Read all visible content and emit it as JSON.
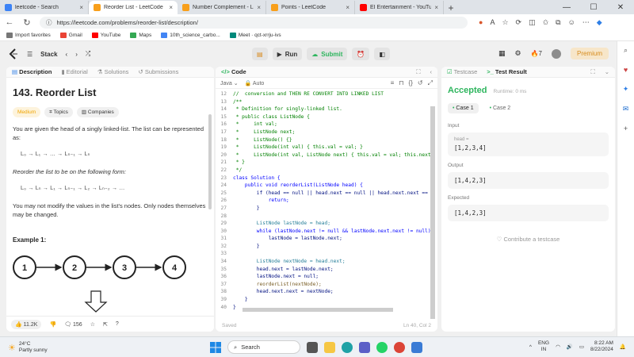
{
  "browser": {
    "tabs": [
      {
        "label": "leetcode - Search",
        "active": false,
        "color": "#3b82f6"
      },
      {
        "label": "Reorder List - LeetCode",
        "active": true,
        "color": "#f89f1b"
      },
      {
        "label": "Number Complement - LeetCode",
        "active": false,
        "color": "#f89f1b"
      },
      {
        "label": "Points - LeetCode",
        "active": false,
        "color": "#f89f1b"
      },
      {
        "label": "EI Entertainment - YouTube",
        "active": false,
        "color": "#ff0000"
      }
    ],
    "url": "https://leetcode.com/problems/reorder-list/description/",
    "bookmarks": [
      {
        "label": "Import favorites",
        "color": "#777777"
      },
      {
        "label": "Gmail",
        "color": "#ea4335"
      },
      {
        "label": "YouTube",
        "color": "#ff0000"
      },
      {
        "label": "Maps",
        "color": "#34a853"
      },
      {
        "label": "10th_science_carbo...",
        "color": "#4285f4"
      },
      {
        "label": "Meet · qct-xrrju-ivs",
        "color": "#00897b"
      }
    ]
  },
  "header": {
    "problem_list": "Stack",
    "run": "Run",
    "submit": "Submit",
    "streak": "7",
    "premium": "Premium"
  },
  "description": {
    "tabs": [
      "Description",
      "Editorial",
      "Solutions",
      "Submissions"
    ],
    "title": "143. Reorder List",
    "difficulty": "Medium",
    "topics": "Topics",
    "companies": "Companies",
    "para1": "You are given the head of a singly linked-list. The list can be represented as:",
    "math1": "L₀ → L₁ → … → Lₙ₋₁ → Lₙ",
    "para2": "Reorder the list to be on the following form:",
    "math2": "L₀ → Lₙ → L₁ → Lₙ₋₁ → L₂ → Lₙ₋₂ → …",
    "para3": "You may not modify the values in the list's nodes. Only nodes themselves may be changed.",
    "example": "Example 1:",
    "nodes": [
      "1",
      "2",
      "3",
      "4"
    ],
    "likes": "11.2K",
    "comments": "156"
  },
  "code": {
    "title": "Code",
    "language": "Java",
    "auto": "Auto",
    "saved": "Saved",
    "position": "Ln 40, Col 2",
    "lines": [
      {
        "n": "12",
        "t": "//  conversion and THEN RE CONVERT INTO LINKED LIST",
        "c": "cm"
      },
      {
        "n": "13",
        "t": "/**",
        "c": "cm"
      },
      {
        "n": "14",
        "t": " * Definition for singly-linked list.",
        "c": "cm"
      },
      {
        "n": "15",
        "t": " * public class ListNode {",
        "c": "cm"
      },
      {
        "n": "16",
        "t": " *     int val;",
        "c": "cm"
      },
      {
        "n": "17",
        "t": " *     ListNode next;",
        "c": "cm"
      },
      {
        "n": "18",
        "t": " *     ListNode() {}",
        "c": "cm"
      },
      {
        "n": "19",
        "t": " *     ListNode(int val) { this.val = val; }",
        "c": "cm"
      },
      {
        "n": "20",
        "t": " *     ListNode(int val, ListNode next) { this.val = val; this.next",
        "c": "cm"
      },
      {
        "n": "21",
        "t": " * }",
        "c": "cm"
      },
      {
        "n": "22",
        "t": " */",
        "c": "cm"
      },
      {
        "n": "23",
        "t": "class Solution {",
        "c": "kw"
      },
      {
        "n": "24",
        "t": "    public void reorderList(ListNode head) {",
        "c": "kw"
      },
      {
        "n": "25",
        "t": "        if (head == null || head.next == null || head.next.next ==",
        "c": "pl"
      },
      {
        "n": "26",
        "t": "            return;",
        "c": "kw"
      },
      {
        "n": "27",
        "t": "        }",
        "c": "pl"
      },
      {
        "n": "28",
        "t": "",
        "c": "pl"
      },
      {
        "n": "29",
        "t": "        ListNode lastNode = head;",
        "c": "ty"
      },
      {
        "n": "30",
        "t": "        while (lastNode.next != null && lastNode.next.next != null)",
        "c": "kw"
      },
      {
        "n": "31",
        "t": "            lastNode = lastNode.next;",
        "c": "pl"
      },
      {
        "n": "32",
        "t": "        }",
        "c": "pl"
      },
      {
        "n": "33",
        "t": "",
        "c": "pl"
      },
      {
        "n": "34",
        "t": "        ListNode nextNode = head.next;",
        "c": "ty"
      },
      {
        "n": "35",
        "t": "        head.next = lastNode.next;",
        "c": "pl"
      },
      {
        "n": "36",
        "t": "        lastNode.next = null;",
        "c": "pl"
      },
      {
        "n": "37",
        "t": "        reorderList(nextNode);",
        "c": "fn"
      },
      {
        "n": "38",
        "t": "        head.next.next = nextNode;",
        "c": "pl"
      },
      {
        "n": "39",
        "t": "    }",
        "c": "pl"
      },
      {
        "n": "40",
        "t": "}",
        "c": "pl"
      }
    ]
  },
  "result": {
    "tabs": [
      "Testcase",
      "Test Result"
    ],
    "status": "Accepted",
    "runtime": "Runtime: 0 ms",
    "case1": "Case 1",
    "case2": "Case 2",
    "input_label": "Input",
    "input_name": "head =",
    "input_value": "[1,2,3,4]",
    "output_label": "Output",
    "output_value": "[1,4,2,3]",
    "expected_label": "Expected",
    "expected_value": "[1,4,2,3]",
    "contribute": "Contribute a testcase"
  },
  "taskbar": {
    "temp": "24°C",
    "weather": "Partly sunny",
    "search": "Search",
    "lang": "ENG",
    "region": "IN",
    "time": "8:22 AM",
    "date": "8/22/2024"
  }
}
